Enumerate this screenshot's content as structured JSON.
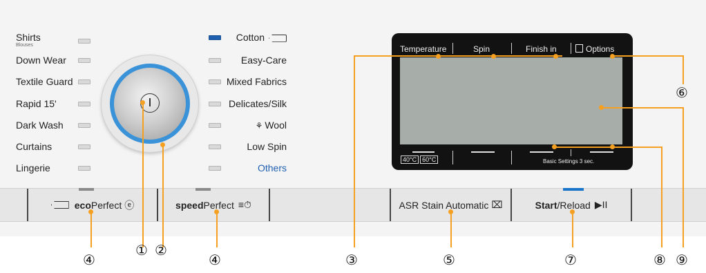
{
  "left_programs": [
    {
      "label": "Shirts",
      "sub": "Blouses"
    },
    {
      "label": "Down Wear"
    },
    {
      "label": "Textile Guard"
    },
    {
      "label": "Rapid 15'"
    },
    {
      "label": "Dark Wash"
    },
    {
      "label": "Curtains"
    },
    {
      "label": "Lingerie"
    }
  ],
  "right_programs": [
    {
      "label": "Cotton",
      "icon": "cotton-basket-icon",
      "led_on": true
    },
    {
      "label": "Easy-Care"
    },
    {
      "label": "Mixed Fabrics"
    },
    {
      "label": "Delicates/Silk"
    },
    {
      "label": "Wool",
      "icon": "wool-hand-icon"
    },
    {
      "label": "Low Spin"
    },
    {
      "label": "Others",
      "color": "#1f5fb0"
    }
  ],
  "buttons": {
    "eco": {
      "bold": "eco",
      "rest": "Perfect",
      "icon": "eco-e-icon"
    },
    "speed": {
      "bold": "speed",
      "rest": "Perfect",
      "icon": "stopwatch-icon"
    },
    "asr": {
      "label": "ASR Stain Automatic",
      "icon": "stain-icon"
    },
    "start": {
      "bold": "Start",
      "rest": "/Reload",
      "icon": "play-pause-icon"
    }
  },
  "display": {
    "top_labels": [
      "Temperature",
      "Spin",
      "Finish in",
      "Options"
    ],
    "options_icon": "menu-list-icon",
    "temp_small": [
      "40°C",
      "60°C"
    ],
    "basic_settings": "Basic Settings 3 sec."
  },
  "callouts": [
    "①",
    "②",
    "③",
    "④",
    "④",
    "⑤",
    "⑥",
    "⑦",
    "⑧",
    "⑨"
  ],
  "colors": {
    "accent": "#f5a021",
    "led_on": "#1f5fb0",
    "ring": "#3a92d8",
    "start_tab": "#1a76c9"
  }
}
